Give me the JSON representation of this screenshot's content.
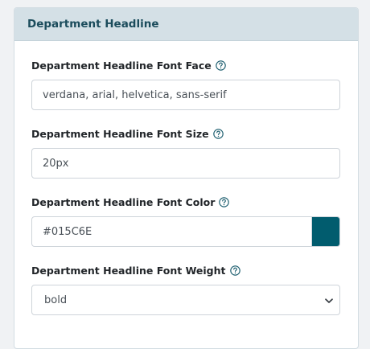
{
  "panel": {
    "title": "Department Headline"
  },
  "fields": {
    "font_face": {
      "label": "Department Headline Font Face",
      "value": "verdana, arial, helvetica, sans-serif"
    },
    "font_size": {
      "label": "Department Headline Font Size",
      "value": "20px"
    },
    "font_color": {
      "label": "Department Headline Font Color",
      "value": "#015C6E",
      "swatch_color": "#015C6E"
    },
    "font_weight": {
      "label": "Department Headline Font Weight",
      "selected": "bold"
    }
  },
  "icons": {
    "help": "question-circle-icon",
    "caret": "chevron-down-icon"
  },
  "colors": {
    "header_bg": "#d4e0e6",
    "header_text": "#1b4c5c",
    "help_icon": "#1b5d6e"
  }
}
